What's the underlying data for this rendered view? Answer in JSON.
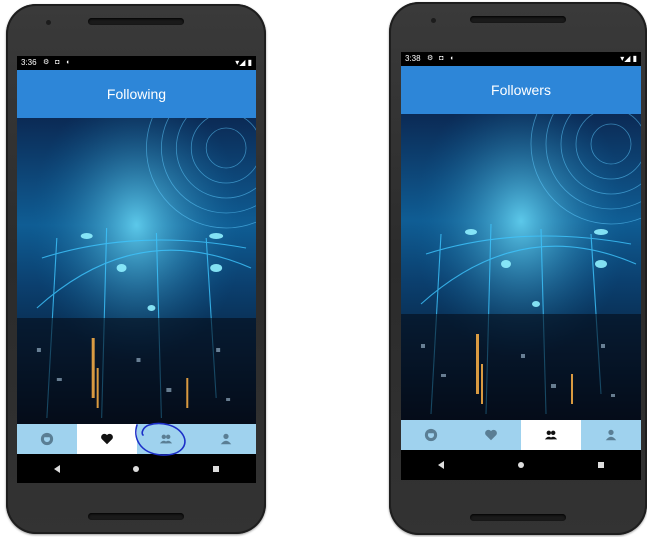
{
  "left_phone": {
    "status_time": "3:36",
    "title": "Following",
    "active_tab": "favorites",
    "tabs": [
      "github-icon",
      "heart-icon",
      "people-icon",
      "person-icon"
    ]
  },
  "right_phone": {
    "status_time": "3:38",
    "title": "Followers",
    "active_tab": "followers",
    "tabs": [
      "github-icon",
      "heart-icon",
      "people-icon",
      "person-icon"
    ]
  },
  "colors": {
    "app_bar": "#2d86d8",
    "tab_bar": "#9fd2ee",
    "tab_active": "#ffffff",
    "annotation": "#1c2fc8"
  }
}
